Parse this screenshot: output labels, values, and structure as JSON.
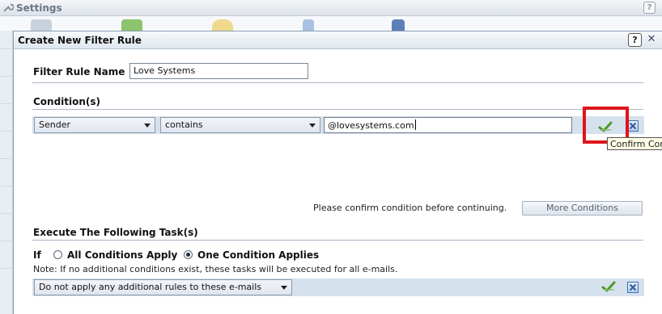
{
  "background_window": {
    "title": "Settings",
    "help_label": "?"
  },
  "dialog": {
    "title": "Create New Filter Rule",
    "help_label": "?",
    "close_label": "✕"
  },
  "filter_rule_name": {
    "label": "Filter Rule Name",
    "value": "Love Systems"
  },
  "conditions": {
    "heading": "Condition(s)",
    "field_select": "Sender",
    "operator_select": "contains",
    "value_input": "@lovesystems.com",
    "confirm_tooltip": "Confirm Condition",
    "status_message": "Please confirm condition before continuing.",
    "more_conditions_label": "More Conditions"
  },
  "tasks": {
    "heading": "Execute The Following Task(s)",
    "if_label": "If",
    "option_all": "All Conditions Apply",
    "option_one": "One Condition Applies",
    "selected_option": "One Condition Applies",
    "note": "Note: If no additional conditions exist, these tasks will be executed for all e-mails.",
    "task_select": "Do not apply any additional rules to these e-mails"
  },
  "colors": {
    "highlight_box": "#e0141b",
    "confirm_check": "#4f9a2a",
    "row_background": "#d6e1ee"
  },
  "icons": {
    "confirm": "checkmark-icon",
    "cancel": "close-x-icon",
    "settings": "wrench-icon"
  }
}
